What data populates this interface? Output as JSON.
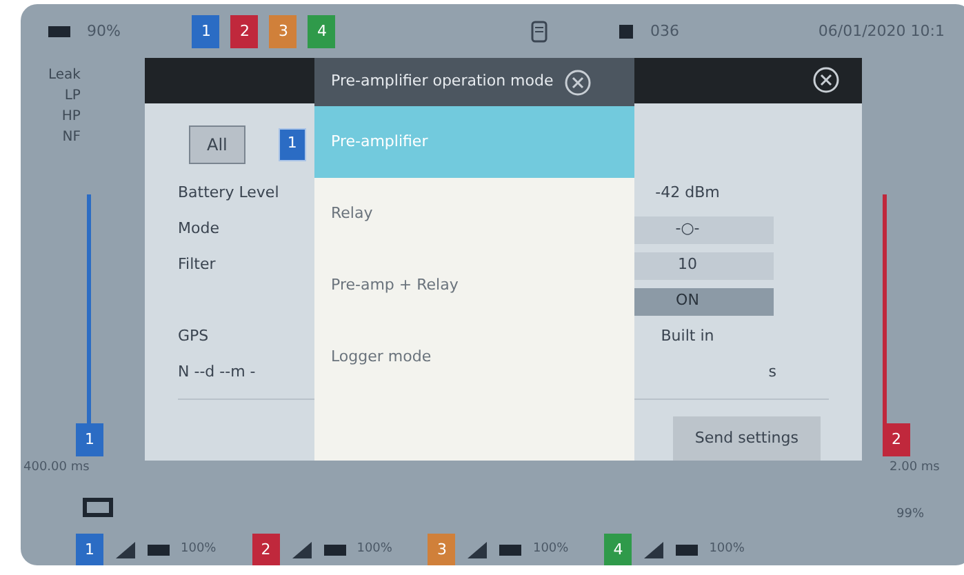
{
  "status_bar": {
    "battery": "90%",
    "channels": [
      {
        "label": "1",
        "color": "#2b6cc4"
      },
      {
        "label": "2",
        "color": "#c0283c"
      },
      {
        "label": "3",
        "color": "#d0803a"
      },
      {
        "label": "4",
        "color": "#2f9a4a"
      }
    ],
    "memory": "036",
    "datetime": "06/01/2020 10:1"
  },
  "background": {
    "legend": [
      "Leak",
      "LP",
      "HP",
      "NF"
    ],
    "left_meter": {
      "badge": "1",
      "color": "#2b6cc4",
      "reading": "400.00 ms"
    },
    "right_meter": {
      "badge": "2",
      "color": "#c0283c",
      "reading": "2.00 ms"
    },
    "summary": "99%"
  },
  "channel_bar": [
    {
      "label": "1",
      "color": "#2b6cc4",
      "battery": "100%"
    },
    {
      "label": "2",
      "color": "#c0283c",
      "battery": "100%"
    },
    {
      "label": "3",
      "color": "#d0803a",
      "battery": "100%"
    },
    {
      "label": "4",
      "color": "#2f9a4a",
      "battery": "100%"
    }
  ],
  "settings_dialog": {
    "all_button": "All",
    "channel_badge": {
      "label": "1",
      "color": "#2b6cc4"
    },
    "rows": [
      {
        "kind": "text",
        "label": "Battery Level",
        "value": "-42 dBm"
      },
      {
        "kind": "field",
        "label": "Mode",
        "value": "-○-"
      },
      {
        "kind": "field",
        "label": "Filter",
        "value": "10"
      },
      {
        "kind": "toggle",
        "value": "ON",
        "on": true
      },
      {
        "kind": "text",
        "label": "GPS",
        "value": "Built in"
      }
    ],
    "coordinates": "N --d --m -",
    "coordinates_end": "s",
    "send_button": "Send settings"
  },
  "mode_dialog": {
    "title": "Pre-amplifier operation mode",
    "options": [
      {
        "label": "Pre-amplifier",
        "selected": true
      },
      {
        "label": "Relay",
        "selected": false
      },
      {
        "label": "Pre-amp + Relay",
        "selected": false
      },
      {
        "label": "Logger mode",
        "selected": false
      }
    ]
  }
}
